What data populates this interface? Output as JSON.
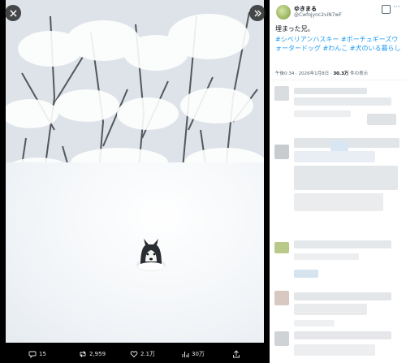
{
  "viewer": {
    "close_icon": "close-icon",
    "next_icon": "chevron-double-right-icon",
    "actions": {
      "replies": "15",
      "reposts": "2,959",
      "likes": "2.1万",
      "views": "30万"
    }
  },
  "tweet": {
    "author_name": "ゆきまる",
    "author_handle": "@Cwfojync2viN7wF",
    "text": "埋まった兄。",
    "hashtags": "#シベリアンハスキー #ボーチュギーズウォータードッグ #わんこ #犬のいる暮らし",
    "timestamp": "午後0:34 · 2026年1月8日 · ",
    "views_count": "30.3万",
    "views_label": " 件の表示"
  },
  "colors": {
    "accent": "#1d9bf0",
    "background_dark": "#000000",
    "panel_bg": "#ffffff"
  }
}
